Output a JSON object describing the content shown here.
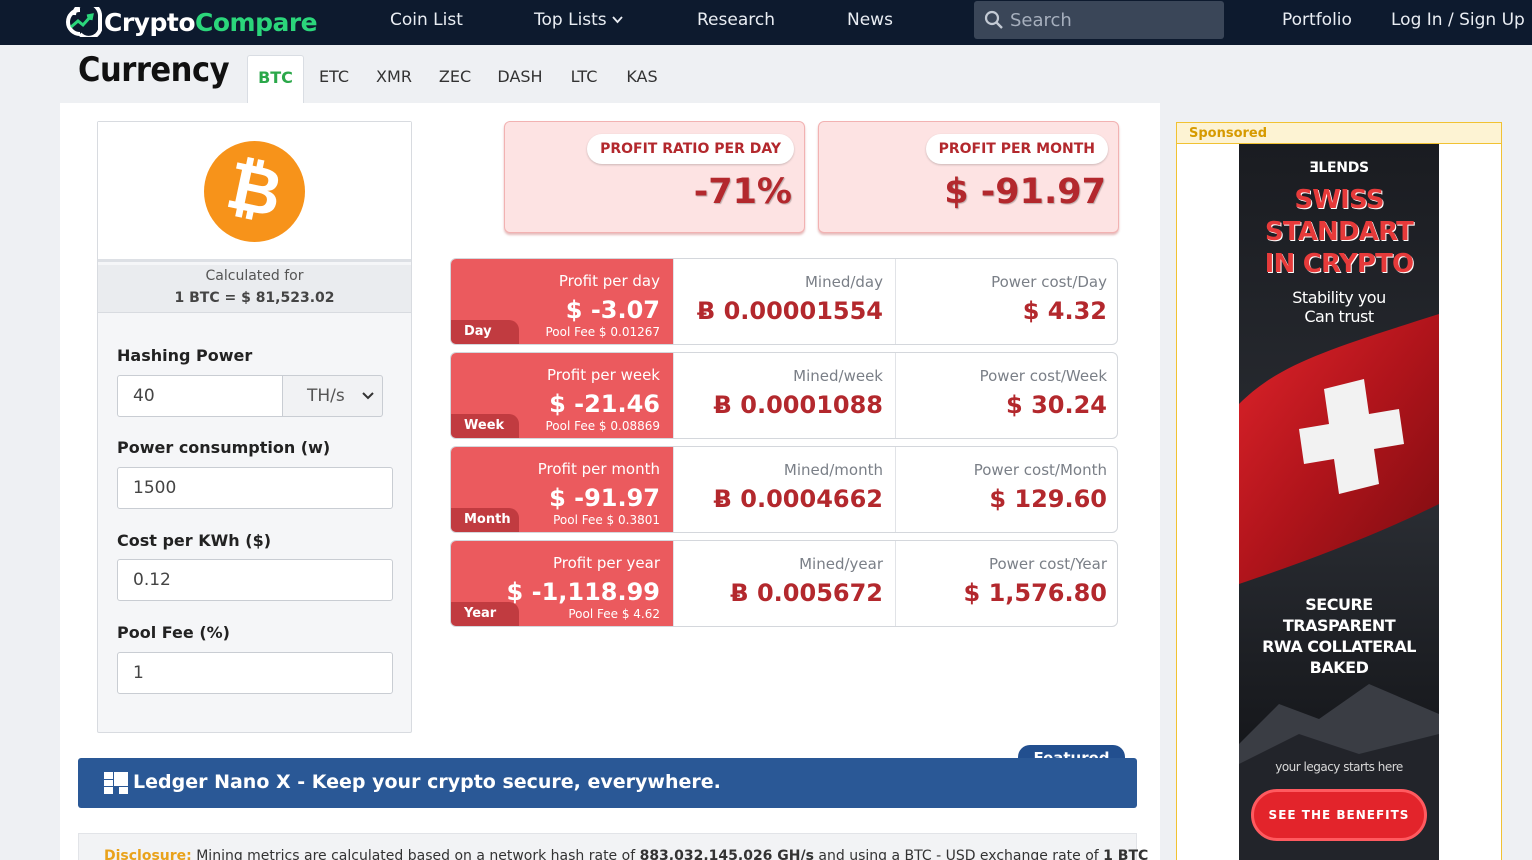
{
  "nav": {
    "logo_part1": "Crypto",
    "logo_part2": "Compare",
    "links": [
      "Coin List",
      "Top Lists",
      "Research",
      "News"
    ],
    "search_placeholder": "Search",
    "portfolio": "Portfolio",
    "login": "Log In / Sign Up"
  },
  "page": {
    "title": "Currency",
    "tabs": [
      "BTC",
      "ETC",
      "XMR",
      "ZEC",
      "DASH",
      "LTC",
      "KAS"
    ],
    "active_tab": "BTC"
  },
  "calc": {
    "calculated_for": "Calculated for",
    "rate": "1 BTC = $ 81,523.02",
    "coin_glyph": "₿",
    "fields": {
      "hashing_label": "Hashing Power",
      "hashing_value": "40",
      "hashing_unit": "TH/s",
      "power_label": "Power consumption (w)",
      "power_value": "1500",
      "cost_label": "Cost per KWh ($)",
      "cost_value": "0.12",
      "fee_label": "Pool Fee (%)",
      "fee_value": "1"
    }
  },
  "summary": {
    "ratio_label": "PROFIT RATIO PER DAY",
    "ratio_value": "-71%",
    "month_label": "PROFIT PER MONTH",
    "month_value": "$ -91.97"
  },
  "rows": [
    {
      "profit_label": "Profit per day",
      "profit": "$ -3.07",
      "fee": "Pool Fee $ 0.01267",
      "tag": "Day",
      "mined_label": "Mined/day",
      "mined": "Ƀ 0.00001554",
      "power_label": "Power cost/Day",
      "power": "$ 4.32"
    },
    {
      "profit_label": "Profit per week",
      "profit": "$ -21.46",
      "fee": "Pool Fee $ 0.08869",
      "tag": "Week",
      "mined_label": "Mined/week",
      "mined": "Ƀ 0.0001088",
      "power_label": "Power cost/Week",
      "power": "$ 30.24"
    },
    {
      "profit_label": "Profit per month",
      "profit": "$ -91.97",
      "fee": "Pool Fee $ 0.3801",
      "tag": "Month",
      "mined_label": "Mined/month",
      "mined": "Ƀ 0.0004662",
      "power_label": "Power cost/Month",
      "power": "$ 129.60"
    },
    {
      "profit_label": "Profit per year",
      "profit": "$ -1,118.99",
      "fee": "Pool Fee $ 4.62",
      "tag": "Year",
      "mined_label": "Mined/year",
      "mined": "Ƀ 0.005672",
      "power_label": "Power cost/Year",
      "power": "$ 1,576.80"
    }
  ],
  "featured": {
    "tab": "Featured",
    "text": "Ledger Nano X - Keep your crypto secure, everywhere."
  },
  "disclosure": {
    "label": "Disclosure:",
    "text1": " Mining metrics are calculated based on a network hash rate of ",
    "hashrate": "883,032,145,026 GH/s",
    "text2": " and using a BTC - USD exchange rate of ",
    "rate": "1 BTC"
  },
  "ad": {
    "sponsored": "Sponsored",
    "brand": "ƎLENDS",
    "headline1": "SWISS",
    "headline2": "STANDART",
    "headline3": "IN CRYPTO",
    "sub1": "Stability you",
    "sub2": "Can trust",
    "body1": "SECURE",
    "body2": "TRASPARENT",
    "body3": "RWA COLLATERAL",
    "body4": "BAKED",
    "tagline": "your legacy starts here",
    "cta": "SEE THE BENEFITS"
  }
}
